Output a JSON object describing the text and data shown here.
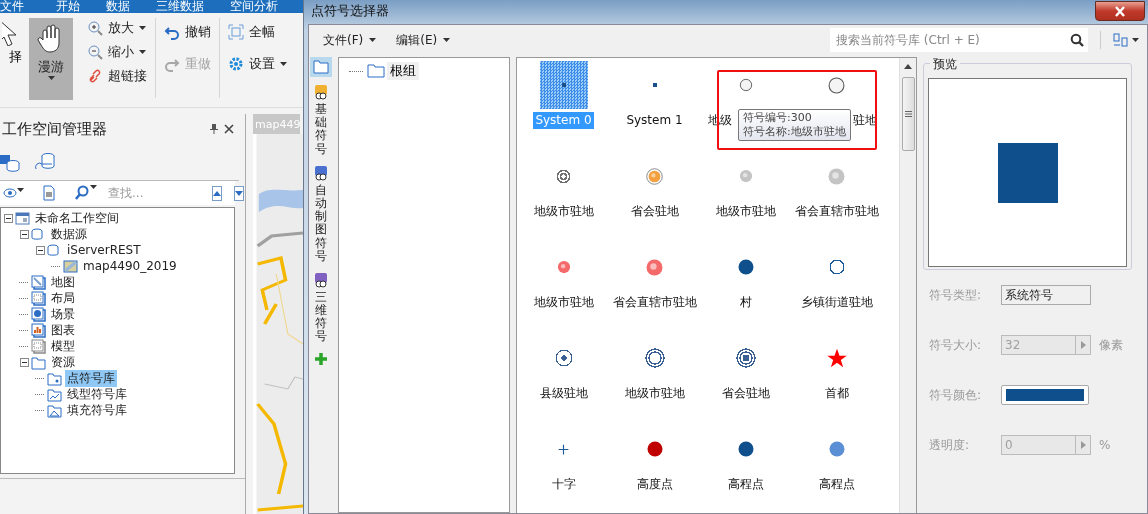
{
  "app_menu": [
    "文件",
    "开始",
    "数据",
    "三维数据",
    "空间分析"
  ],
  "ribbon": {
    "select": {
      "label": "择"
    },
    "pan": {
      "label": "漫游",
      "selected": true
    },
    "groups": [
      [
        {
          "label": "放大",
          "kind": "zoomin",
          "dropdown": true,
          "disabled": false
        },
        {
          "label": "缩小",
          "kind": "zoomout",
          "dropdown": true,
          "disabled": false
        },
        {
          "label": "超链接",
          "kind": "link",
          "dropdown": false,
          "disabled": false
        }
      ],
      [
        {
          "label": "撤销",
          "kind": "undo",
          "dropdown": false,
          "disabled": false
        },
        {
          "label": "重做",
          "kind": "redo",
          "dropdown": false,
          "disabled": true
        }
      ],
      [
        {
          "label": "全幅",
          "kind": "fullextent",
          "dropdown": false,
          "disabled": false
        },
        {
          "label": "设置",
          "kind": "settings",
          "dropdown": true,
          "disabled": false
        }
      ]
    ]
  },
  "workspace_panel": {
    "title": "工作空间管理器",
    "search": {
      "placeholder": "查找..."
    },
    "tree": [
      {
        "label": "未命名工作空间",
        "kind": "workspace",
        "expanded": true,
        "selected": false,
        "children": [
          {
            "label": "数据源",
            "kind": "datasource",
            "expanded": true,
            "selected": false,
            "children": [
              {
                "label": "iServerREST",
                "kind": "server",
                "expanded": true,
                "selected": false,
                "children": [
                  {
                    "label": "map4490_2019",
                    "kind": "dataset",
                    "selected": false
                  }
                ]
              }
            ]
          },
          {
            "label": "地图",
            "kind": "map",
            "selected": false
          },
          {
            "label": "布局",
            "kind": "layout",
            "selected": false
          },
          {
            "label": "场景",
            "kind": "scene",
            "selected": false
          },
          {
            "label": "图表",
            "kind": "chart",
            "selected": false
          },
          {
            "label": "模型",
            "kind": "model",
            "selected": false
          },
          {
            "label": "资源",
            "kind": "folder",
            "expanded": true,
            "selected": false,
            "children": [
              {
                "label": "点符号库",
                "kind": "pointlib",
                "selected": true
              },
              {
                "label": "线型符号库",
                "kind": "linelib",
                "selected": false
              },
              {
                "label": "填充符号库",
                "kind": "filllib",
                "selected": false
              }
            ]
          }
        ]
      }
    ]
  },
  "map_tab": {
    "title": "map449"
  },
  "dialog": {
    "title": "点符号选择器",
    "menus": [
      "文件(F)",
      "编辑(E)"
    ],
    "search": {
      "placeholder": "搜索当前符号库 (Ctrl + E)"
    },
    "side_tabs": [
      {
        "label": "基础符号",
        "kind": "basic"
      },
      {
        "label": "自动制图符号",
        "kind": "auto"
      },
      {
        "label": "三维符号",
        "kind": "three"
      }
    ],
    "group_tree": {
      "label": "根组"
    },
    "symbols": [
      {
        "label": "System 0",
        "kind": "point",
        "color": "#1b4f8a",
        "selected": true
      },
      {
        "label": "System 1",
        "kind": "point",
        "color": "#1b4f8a",
        "selected": false
      },
      {
        "label": "地级",
        "kind": "bubble",
        "color": "#f4f4f4",
        "selected": false
      },
      {
        "label": "驻地",
        "kind": "bigbubble",
        "color": "#f4f4f4",
        "selected": false
      },
      {
        "label": "地级市驻地",
        "kind": "ring",
        "color": "#707070",
        "selected": false
      },
      {
        "label": "省会驻地",
        "kind": "haloball",
        "color": "#f4a040",
        "selected": false
      },
      {
        "label": "地级市驻地",
        "kind": "ball",
        "color": "#c4c4c4",
        "selected": false
      },
      {
        "label": "省会直辖市驻地",
        "kind": "bigball",
        "color": "#c4c4c4",
        "selected": false
      },
      {
        "label": "地级市驻地",
        "kind": "ball",
        "color": "#f46a6a",
        "selected": false
      },
      {
        "label": "省会直辖市驻地",
        "kind": "bigball",
        "color": "#f46a6a",
        "selected": false
      },
      {
        "label": "村",
        "kind": "disc",
        "color": "#0e4f8c",
        "selected": false
      },
      {
        "label": "乡镇街道驻地",
        "kind": "circle",
        "color": "#1b5a9a",
        "selected": false
      },
      {
        "label": "县级驻地",
        "kind": "dotring",
        "color": "#3a5f95",
        "selected": false
      },
      {
        "label": "地级市驻地",
        "kind": "doublering",
        "color": "#3a5f95",
        "selected": false
      },
      {
        "label": "省会驻地",
        "kind": "target",
        "color": "#3a5f95",
        "selected": false
      },
      {
        "label": "首都",
        "kind": "star",
        "color": "#ff0000",
        "selected": false
      },
      {
        "label": "十字",
        "kind": "cross",
        "color": "#1b5a9a",
        "selected": false
      },
      {
        "label": "高度点",
        "kind": "disc",
        "color": "#c00000",
        "selected": false
      },
      {
        "label": "高程点",
        "kind": "disc",
        "color": "#0e4f8c",
        "selected": false
      },
      {
        "label": "高程点",
        "kind": "disc",
        "color": "#5a8fd6",
        "selected": false
      }
    ],
    "tooltip": [
      "符号编号:300",
      "符号名称:地级市驻地"
    ],
    "preview": {
      "title": "预览",
      "color": "#0e4f8c"
    },
    "properties": [
      {
        "label": "符号类型:",
        "kind": "text",
        "value": "系统符号",
        "disabled": false
      },
      {
        "label": "符号大小:",
        "kind": "spinner",
        "value": "32",
        "unit": "像素",
        "disabled": true
      },
      {
        "label": "符号颜色:",
        "kind": "color",
        "color": "#0e4f8c",
        "disabled": false
      },
      {
        "label": "透明度:",
        "kind": "spinner",
        "value": "0",
        "unit": "%",
        "disabled": true
      }
    ]
  }
}
